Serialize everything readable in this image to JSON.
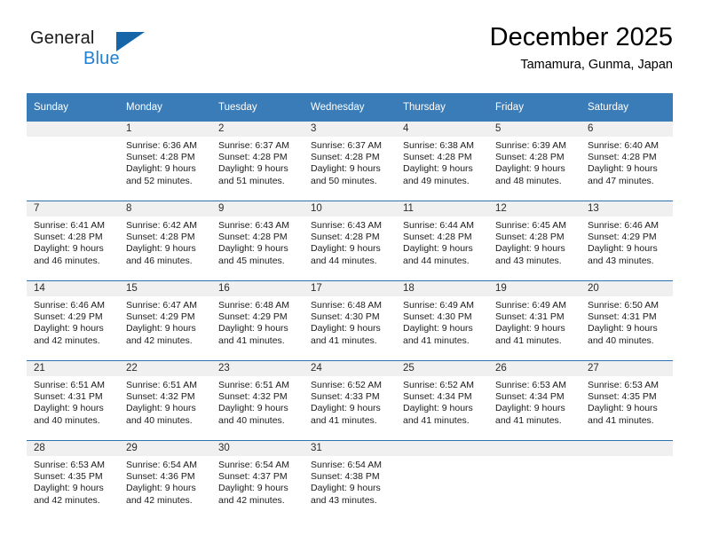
{
  "brand": {
    "name_part1": "General",
    "name_part2": "Blue",
    "triangle_color": "#1565a8",
    "blue_color": "#1f7fd0"
  },
  "header": {
    "month_title": "December 2025",
    "location": "Tamamura, Gunma, Japan"
  },
  "theme": {
    "header_bg": "#3a7cb8",
    "week_divider": "#2e73b0",
    "daynum_band_bg": "#f0f0f0"
  },
  "weekday_headers": [
    "Sunday",
    "Monday",
    "Tuesday",
    "Wednesday",
    "Thursday",
    "Friday",
    "Saturday"
  ],
  "weeks": [
    [
      {
        "day": "",
        "sunrise": "",
        "sunset": "",
        "daylight_line1": "",
        "daylight_line2": ""
      },
      {
        "day": "1",
        "sunrise": "Sunrise: 6:36 AM",
        "sunset": "Sunset: 4:28 PM",
        "daylight_line1": "Daylight: 9 hours",
        "daylight_line2": "and 52 minutes."
      },
      {
        "day": "2",
        "sunrise": "Sunrise: 6:37 AM",
        "sunset": "Sunset: 4:28 PM",
        "daylight_line1": "Daylight: 9 hours",
        "daylight_line2": "and 51 minutes."
      },
      {
        "day": "3",
        "sunrise": "Sunrise: 6:37 AM",
        "sunset": "Sunset: 4:28 PM",
        "daylight_line1": "Daylight: 9 hours",
        "daylight_line2": "and 50 minutes."
      },
      {
        "day": "4",
        "sunrise": "Sunrise: 6:38 AM",
        "sunset": "Sunset: 4:28 PM",
        "daylight_line1": "Daylight: 9 hours",
        "daylight_line2": "and 49 minutes."
      },
      {
        "day": "5",
        "sunrise": "Sunrise: 6:39 AM",
        "sunset": "Sunset: 4:28 PM",
        "daylight_line1": "Daylight: 9 hours",
        "daylight_line2": "and 48 minutes."
      },
      {
        "day": "6",
        "sunrise": "Sunrise: 6:40 AM",
        "sunset": "Sunset: 4:28 PM",
        "daylight_line1": "Daylight: 9 hours",
        "daylight_line2": "and 47 minutes."
      }
    ],
    [
      {
        "day": "7",
        "sunrise": "Sunrise: 6:41 AM",
        "sunset": "Sunset: 4:28 PM",
        "daylight_line1": "Daylight: 9 hours",
        "daylight_line2": "and 46 minutes."
      },
      {
        "day": "8",
        "sunrise": "Sunrise: 6:42 AM",
        "sunset": "Sunset: 4:28 PM",
        "daylight_line1": "Daylight: 9 hours",
        "daylight_line2": "and 46 minutes."
      },
      {
        "day": "9",
        "sunrise": "Sunrise: 6:43 AM",
        "sunset": "Sunset: 4:28 PM",
        "daylight_line1": "Daylight: 9 hours",
        "daylight_line2": "and 45 minutes."
      },
      {
        "day": "10",
        "sunrise": "Sunrise: 6:43 AM",
        "sunset": "Sunset: 4:28 PM",
        "daylight_line1": "Daylight: 9 hours",
        "daylight_line2": "and 44 minutes."
      },
      {
        "day": "11",
        "sunrise": "Sunrise: 6:44 AM",
        "sunset": "Sunset: 4:28 PM",
        "daylight_line1": "Daylight: 9 hours",
        "daylight_line2": "and 44 minutes."
      },
      {
        "day": "12",
        "sunrise": "Sunrise: 6:45 AM",
        "sunset": "Sunset: 4:28 PM",
        "daylight_line1": "Daylight: 9 hours",
        "daylight_line2": "and 43 minutes."
      },
      {
        "day": "13",
        "sunrise": "Sunrise: 6:46 AM",
        "sunset": "Sunset: 4:29 PM",
        "daylight_line1": "Daylight: 9 hours",
        "daylight_line2": "and 43 minutes."
      }
    ],
    [
      {
        "day": "14",
        "sunrise": "Sunrise: 6:46 AM",
        "sunset": "Sunset: 4:29 PM",
        "daylight_line1": "Daylight: 9 hours",
        "daylight_line2": "and 42 minutes."
      },
      {
        "day": "15",
        "sunrise": "Sunrise: 6:47 AM",
        "sunset": "Sunset: 4:29 PM",
        "daylight_line1": "Daylight: 9 hours",
        "daylight_line2": "and 42 minutes."
      },
      {
        "day": "16",
        "sunrise": "Sunrise: 6:48 AM",
        "sunset": "Sunset: 4:29 PM",
        "daylight_line1": "Daylight: 9 hours",
        "daylight_line2": "and 41 minutes."
      },
      {
        "day": "17",
        "sunrise": "Sunrise: 6:48 AM",
        "sunset": "Sunset: 4:30 PM",
        "daylight_line1": "Daylight: 9 hours",
        "daylight_line2": "and 41 minutes."
      },
      {
        "day": "18",
        "sunrise": "Sunrise: 6:49 AM",
        "sunset": "Sunset: 4:30 PM",
        "daylight_line1": "Daylight: 9 hours",
        "daylight_line2": "and 41 minutes."
      },
      {
        "day": "19",
        "sunrise": "Sunrise: 6:49 AM",
        "sunset": "Sunset: 4:31 PM",
        "daylight_line1": "Daylight: 9 hours",
        "daylight_line2": "and 41 minutes."
      },
      {
        "day": "20",
        "sunrise": "Sunrise: 6:50 AM",
        "sunset": "Sunset: 4:31 PM",
        "daylight_line1": "Daylight: 9 hours",
        "daylight_line2": "and 40 minutes."
      }
    ],
    [
      {
        "day": "21",
        "sunrise": "Sunrise: 6:51 AM",
        "sunset": "Sunset: 4:31 PM",
        "daylight_line1": "Daylight: 9 hours",
        "daylight_line2": "and 40 minutes."
      },
      {
        "day": "22",
        "sunrise": "Sunrise: 6:51 AM",
        "sunset": "Sunset: 4:32 PM",
        "daylight_line1": "Daylight: 9 hours",
        "daylight_line2": "and 40 minutes."
      },
      {
        "day": "23",
        "sunrise": "Sunrise: 6:51 AM",
        "sunset": "Sunset: 4:32 PM",
        "daylight_line1": "Daylight: 9 hours",
        "daylight_line2": "and 40 minutes."
      },
      {
        "day": "24",
        "sunrise": "Sunrise: 6:52 AM",
        "sunset": "Sunset: 4:33 PM",
        "daylight_line1": "Daylight: 9 hours",
        "daylight_line2": "and 41 minutes."
      },
      {
        "day": "25",
        "sunrise": "Sunrise: 6:52 AM",
        "sunset": "Sunset: 4:34 PM",
        "daylight_line1": "Daylight: 9 hours",
        "daylight_line2": "and 41 minutes."
      },
      {
        "day": "26",
        "sunrise": "Sunrise: 6:53 AM",
        "sunset": "Sunset: 4:34 PM",
        "daylight_line1": "Daylight: 9 hours",
        "daylight_line2": "and 41 minutes."
      },
      {
        "day": "27",
        "sunrise": "Sunrise: 6:53 AM",
        "sunset": "Sunset: 4:35 PM",
        "daylight_line1": "Daylight: 9 hours",
        "daylight_line2": "and 41 minutes."
      }
    ],
    [
      {
        "day": "28",
        "sunrise": "Sunrise: 6:53 AM",
        "sunset": "Sunset: 4:35 PM",
        "daylight_line1": "Daylight: 9 hours",
        "daylight_line2": "and 42 minutes."
      },
      {
        "day": "29",
        "sunrise": "Sunrise: 6:54 AM",
        "sunset": "Sunset: 4:36 PM",
        "daylight_line1": "Daylight: 9 hours",
        "daylight_line2": "and 42 minutes."
      },
      {
        "day": "30",
        "sunrise": "Sunrise: 6:54 AM",
        "sunset": "Sunset: 4:37 PM",
        "daylight_line1": "Daylight: 9 hours",
        "daylight_line2": "and 42 minutes."
      },
      {
        "day": "31",
        "sunrise": "Sunrise: 6:54 AM",
        "sunset": "Sunset: 4:38 PM",
        "daylight_line1": "Daylight: 9 hours",
        "daylight_line2": "and 43 minutes."
      },
      {
        "day": "",
        "sunrise": "",
        "sunset": "",
        "daylight_line1": "",
        "daylight_line2": ""
      },
      {
        "day": "",
        "sunrise": "",
        "sunset": "",
        "daylight_line1": "",
        "daylight_line2": ""
      },
      {
        "day": "",
        "sunrise": "",
        "sunset": "",
        "daylight_line1": "",
        "daylight_line2": ""
      }
    ]
  ]
}
